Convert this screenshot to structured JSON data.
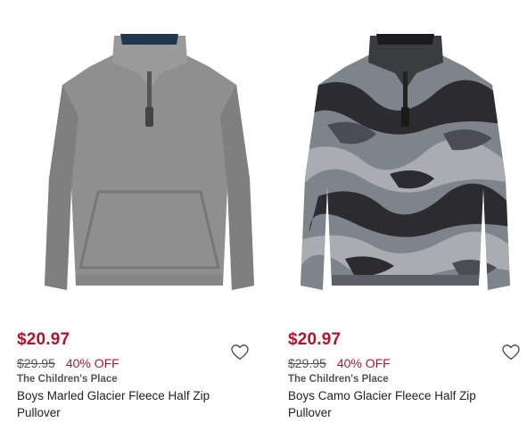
{
  "products": [
    {
      "price": "$20.97",
      "original_price": "$29.95",
      "discount": "40% OFF",
      "brand": "The Children's Place",
      "title": "Boys Marled Glacier Fleece Half Zip Pullover",
      "image_icon": "gray-pullover-image",
      "wishlist_icon": "heart-icon",
      "colors": {
        "fleece": "#8c8c8c",
        "collar_inner": "#1f3650"
      }
    },
    {
      "price": "$20.97",
      "original_price": "$29.95",
      "discount": "40% OFF",
      "brand": "The Children's Place",
      "title": "Boys Camo Glacier Fleece Half Zip Pullover",
      "image_icon": "camo-pullover-image",
      "wishlist_icon": "heart-icon",
      "colors": {
        "camo_base": "#7e848c",
        "camo_dark": "#2c2c30",
        "camo_light": "#a9adb2"
      }
    }
  ],
  "colors": {
    "sale_red": "#b5122b",
    "text_gray": "#555555"
  }
}
